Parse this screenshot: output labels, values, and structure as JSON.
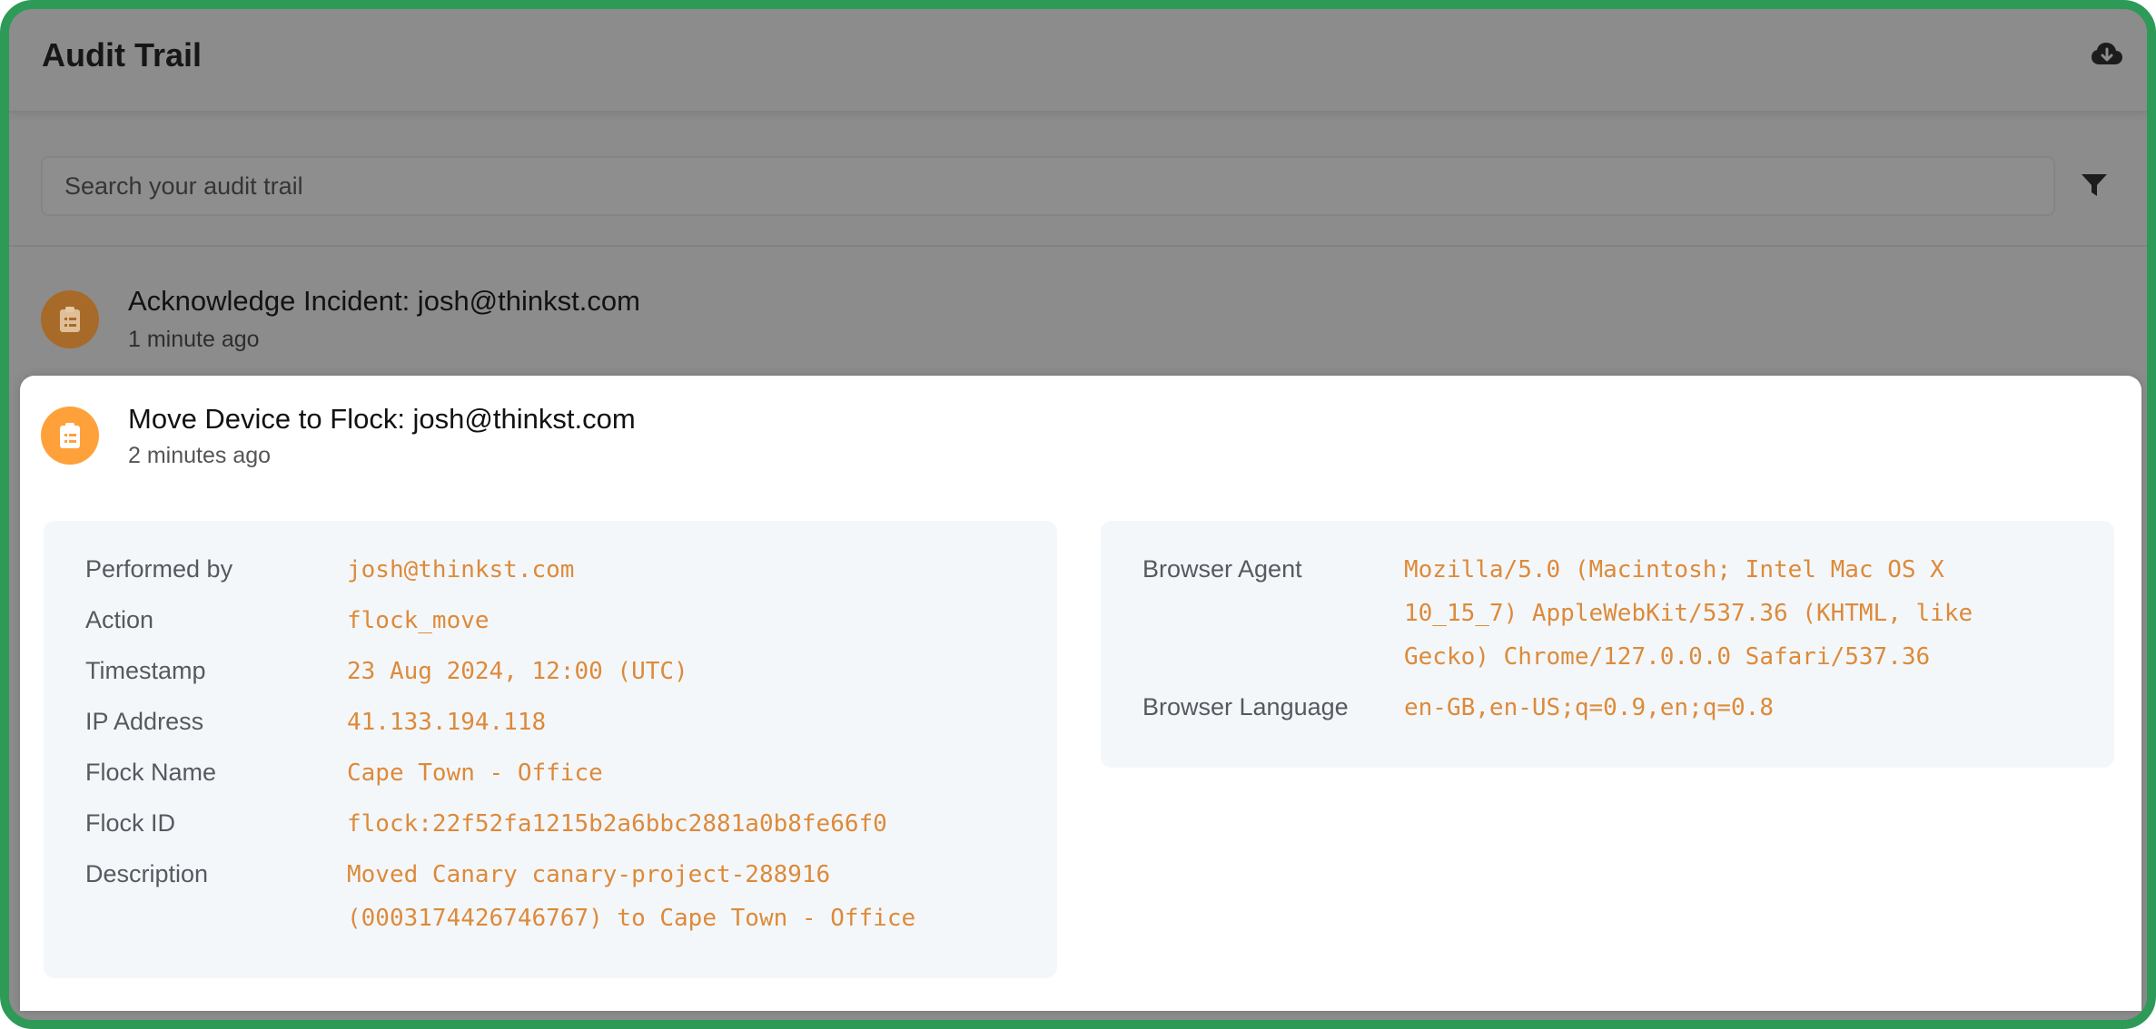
{
  "header": {
    "title": "Audit Trail",
    "download_icon": "cloud-download-icon"
  },
  "search": {
    "placeholder": "Search your audit trail",
    "value": "",
    "filter_icon": "filter-icon"
  },
  "events": [
    {
      "title": "Acknowledge Incident: josh@thinkst.com",
      "time": "1 minute ago",
      "icon": "clipboard-icon",
      "icon_color": "#a86a28"
    },
    {
      "title": "Move Device to Flock: josh@thinkst.com",
      "time": "2 minutes ago",
      "icon": "clipboard-icon",
      "icon_color": "#ffa13a",
      "details": {
        "performed_by_label": "Performed by",
        "performed_by": "josh@thinkst.com",
        "action_label": "Action",
        "action": "flock_move",
        "timestamp_label": "Timestamp",
        "timestamp": "23 Aug 2024, 12:00 (UTC)",
        "ip_label": "IP Address",
        "ip": "41.133.194.118",
        "flock_name_label": "Flock Name",
        "flock_name": "Cape Town - Office",
        "flock_id_label": "Flock ID",
        "flock_id": "flock:22f52fa1215b2a6bbc2881a0b8fe66f0",
        "description_label": "Description",
        "description": "Moved Canary canary-project-288916 (0003174426746767) to Cape Town - Office",
        "browser_agent_label": "Browser Agent",
        "browser_agent": "Mozilla/5.0 (Macintosh; Intel Mac OS X 10_15_7) AppleWebKit/537.36 (KHTML, like Gecko) Chrome/127.0.0.0 Safari/537.36",
        "browser_language_label": "Browser Language",
        "browser_language": "en-GB,en-US;q=0.9,en;q=0.8"
      }
    }
  ],
  "colors": {
    "accent": "#ffa13a",
    "value_text": "#dd8a3a",
    "frame_border": "#2e9a57",
    "overlay": "#8c8c8c"
  }
}
